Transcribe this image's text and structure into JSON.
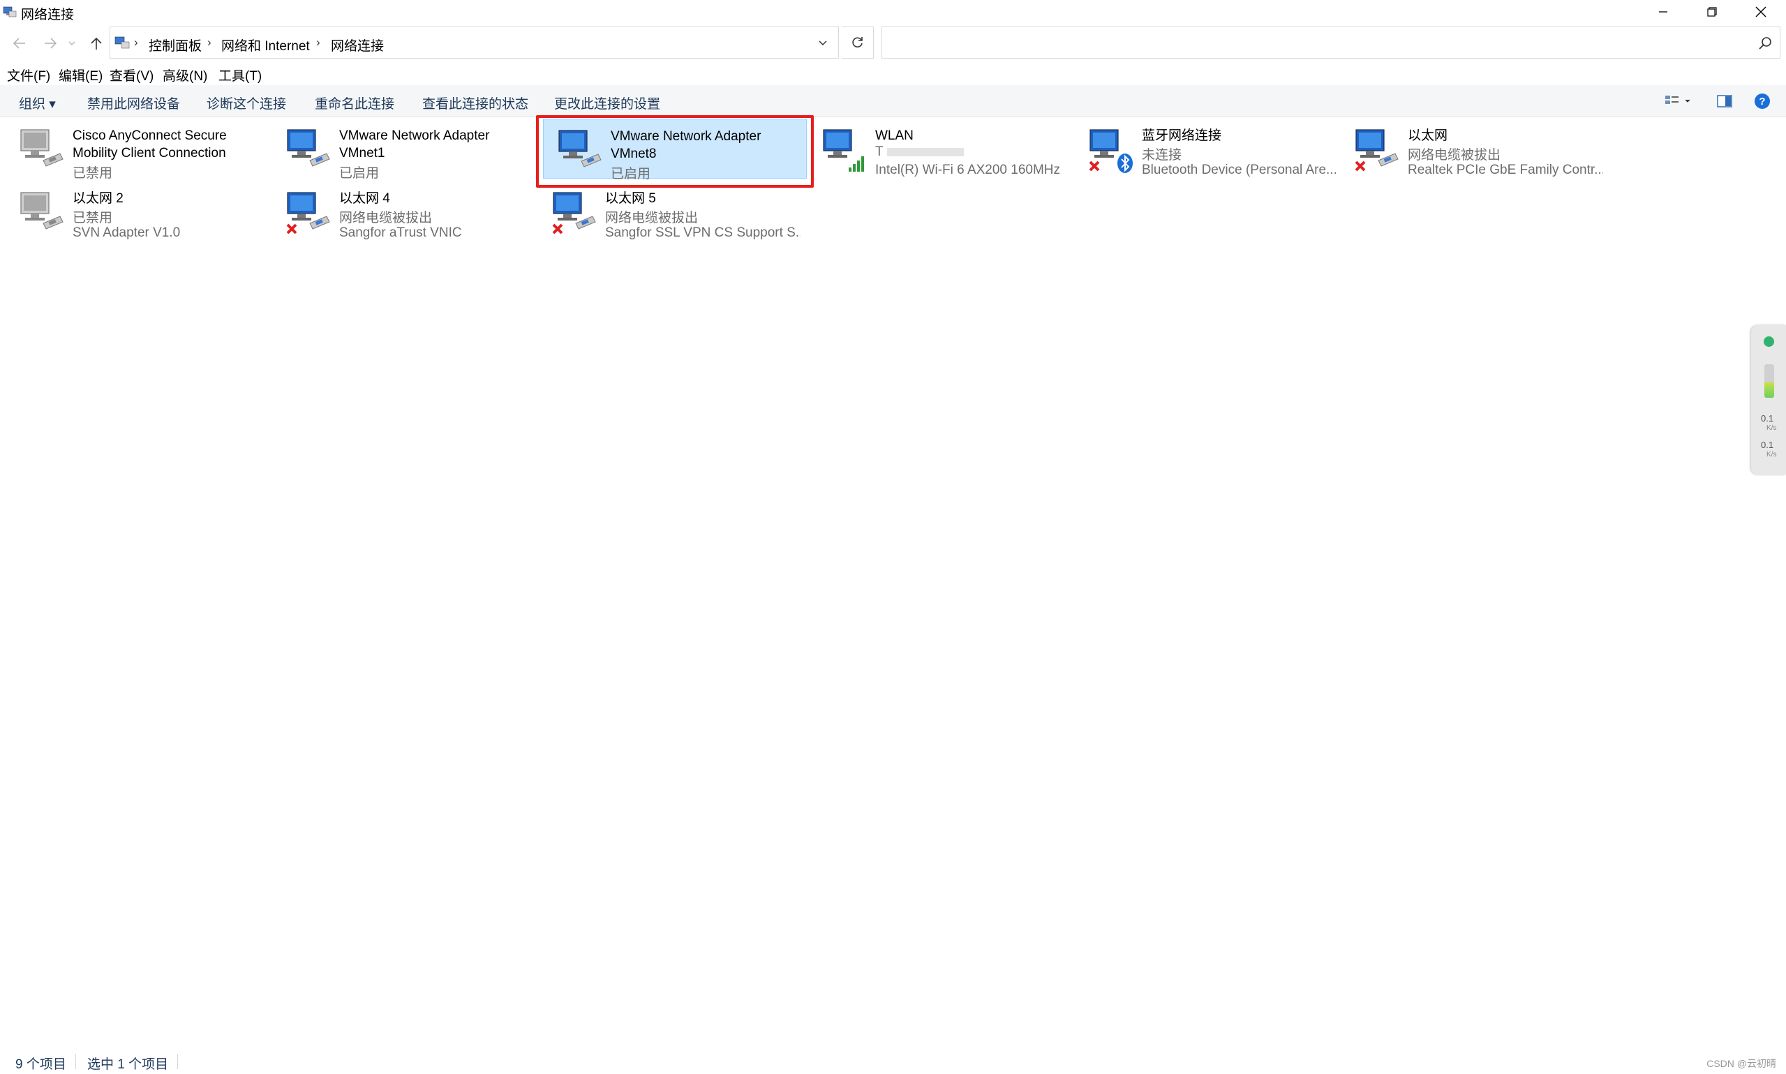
{
  "window": {
    "title": "网络连接",
    "minimize_icon": "minimize-icon",
    "restore_icon": "restore-icon",
    "close_icon": "close-icon"
  },
  "nav": {
    "breadcrumbs": [
      "控制面板",
      "网络和 Internet",
      "网络连接"
    ],
    "search_placeholder": "",
    "search_value": ""
  },
  "menu": [
    "文件(F)",
    "编辑(E)",
    "查看(V)",
    "高级(N)",
    "工具(T)"
  ],
  "commands": {
    "organize": "组织 ▾",
    "items": [
      "禁用此网络设备",
      "诊断这个连接",
      "重命名此连接",
      "查看此连接的状态",
      "更改此连接的设置"
    ]
  },
  "connections": [
    {
      "name": "Cisco AnyConnect Secure Mobility Client Connection",
      "line1": "已禁用",
      "line2": "",
      "state": "disabled"
    },
    {
      "name": "VMware Network Adapter VMnet1",
      "line1": "已启用",
      "line2": "",
      "state": "enabled"
    },
    {
      "name": "VMware Network Adapter VMnet8",
      "line1": "已启用",
      "line2": "",
      "state": "enabled",
      "selected": true
    },
    {
      "name": "WLAN",
      "line1": "T",
      "line2": "Intel(R) Wi-Fi 6 AX200 160MHz",
      "state": "wifi"
    },
    {
      "name": "蓝牙网络连接",
      "line1": "未连接",
      "line2": "Bluetooth Device (Personal Are...",
      "state": "bluetooth-off"
    },
    {
      "name": "以太网",
      "line1": "网络电缆被拔出",
      "line2": "Realtek PCIe GbE Family Contr...",
      "state": "unplugged"
    },
    {
      "name": "以太网 2",
      "line1": "已禁用",
      "line2": "SVN Adapter V1.0",
      "state": "disabled"
    },
    {
      "name": "以太网 4",
      "line1": "网络电缆被拔出",
      "line2": "Sangfor aTrust VNIC",
      "state": "unplugged"
    },
    {
      "name": "以太网 5",
      "line1": "网络电缆被拔出",
      "line2": "Sangfor SSL VPN CS Support S...",
      "state": "unplugged"
    }
  ],
  "netwidget": {
    "up": "0.1",
    "up_unit": "K/s",
    "down": "0.1",
    "down_unit": "K/s"
  },
  "status": {
    "count": "9 个项目",
    "selected": "选中 1 个项目",
    "watermark": "CSDN @云初晴"
  },
  "colors": {
    "accent": "#1e395b",
    "selected_bg": "#cce8ff",
    "highlight_red": "#e5201d"
  }
}
